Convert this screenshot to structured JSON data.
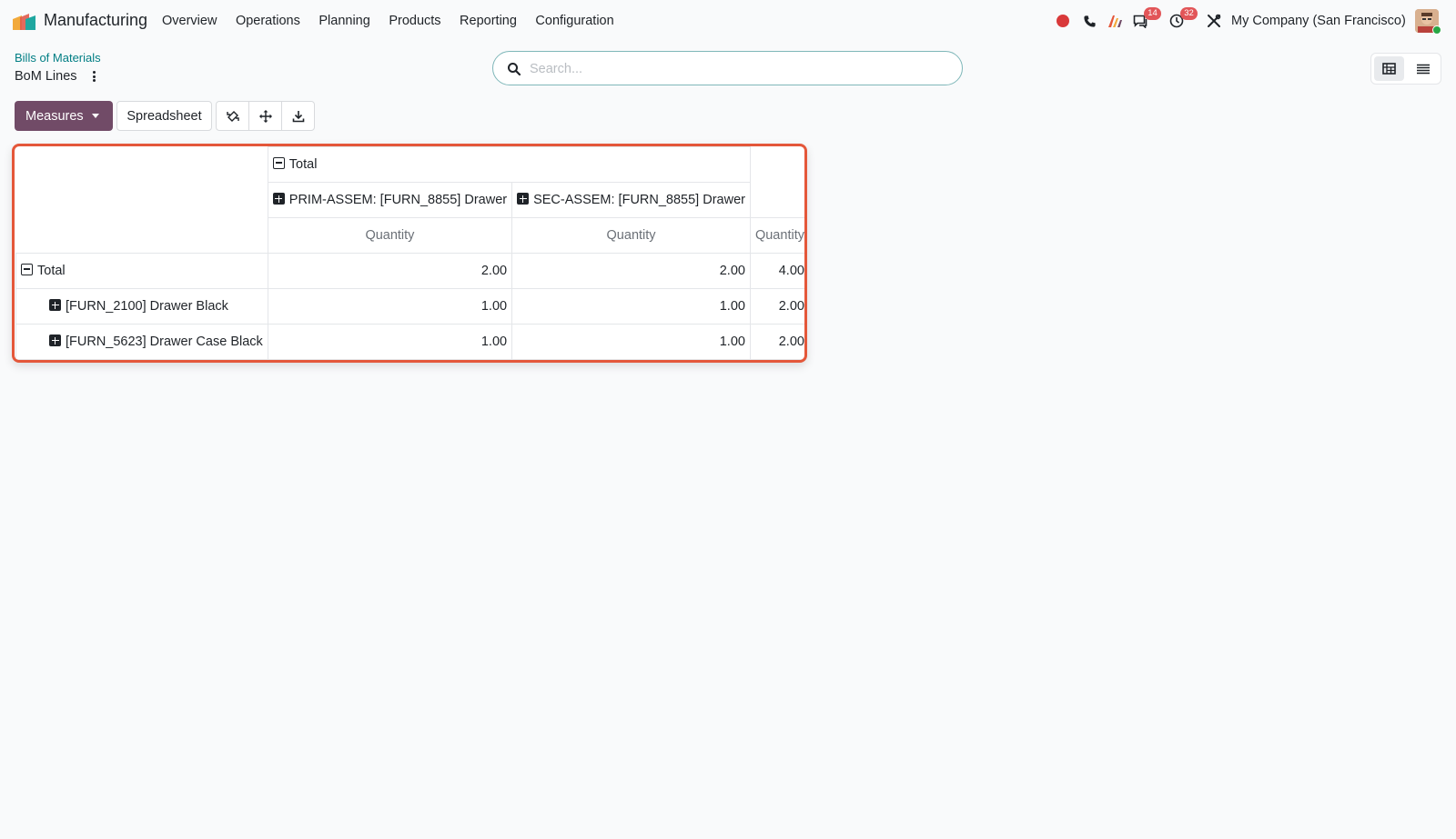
{
  "app": {
    "name": "Manufacturing"
  },
  "menu": [
    "Overview",
    "Operations",
    "Planning",
    "Products",
    "Reporting",
    "Configuration"
  ],
  "systray": {
    "messages_count": "14",
    "activities_count": "32",
    "company": "My Company (San Francisco)"
  },
  "breadcrumb": {
    "parent": "Bills of Materials",
    "current": "BoM Lines"
  },
  "search": {
    "placeholder": "Search..."
  },
  "toolbar": {
    "measures_label": "Measures",
    "spreadsheet_label": "Spreadsheet"
  },
  "pivot": {
    "col_total_label": "Total",
    "col_groups": [
      "PRIM-ASSEM: [FURN_8855] Drawer",
      "SEC-ASSEM: [FURN_8855] Drawer"
    ],
    "measure_label": "Quantity",
    "rows": [
      {
        "label": "Total",
        "values": [
          "2.00",
          "2.00",
          "4.00"
        ]
      },
      {
        "label": "[FURN_2100] Drawer Black",
        "values": [
          "1.00",
          "1.00",
          "2.00"
        ]
      },
      {
        "label": "[FURN_5623] Drawer Case Black",
        "values": [
          "1.00",
          "1.00",
          "2.00"
        ]
      }
    ]
  },
  "colors": {
    "primary": "#714b67",
    "highlight": "#e4573a",
    "link": "#017e84",
    "badge": "#e25558"
  }
}
